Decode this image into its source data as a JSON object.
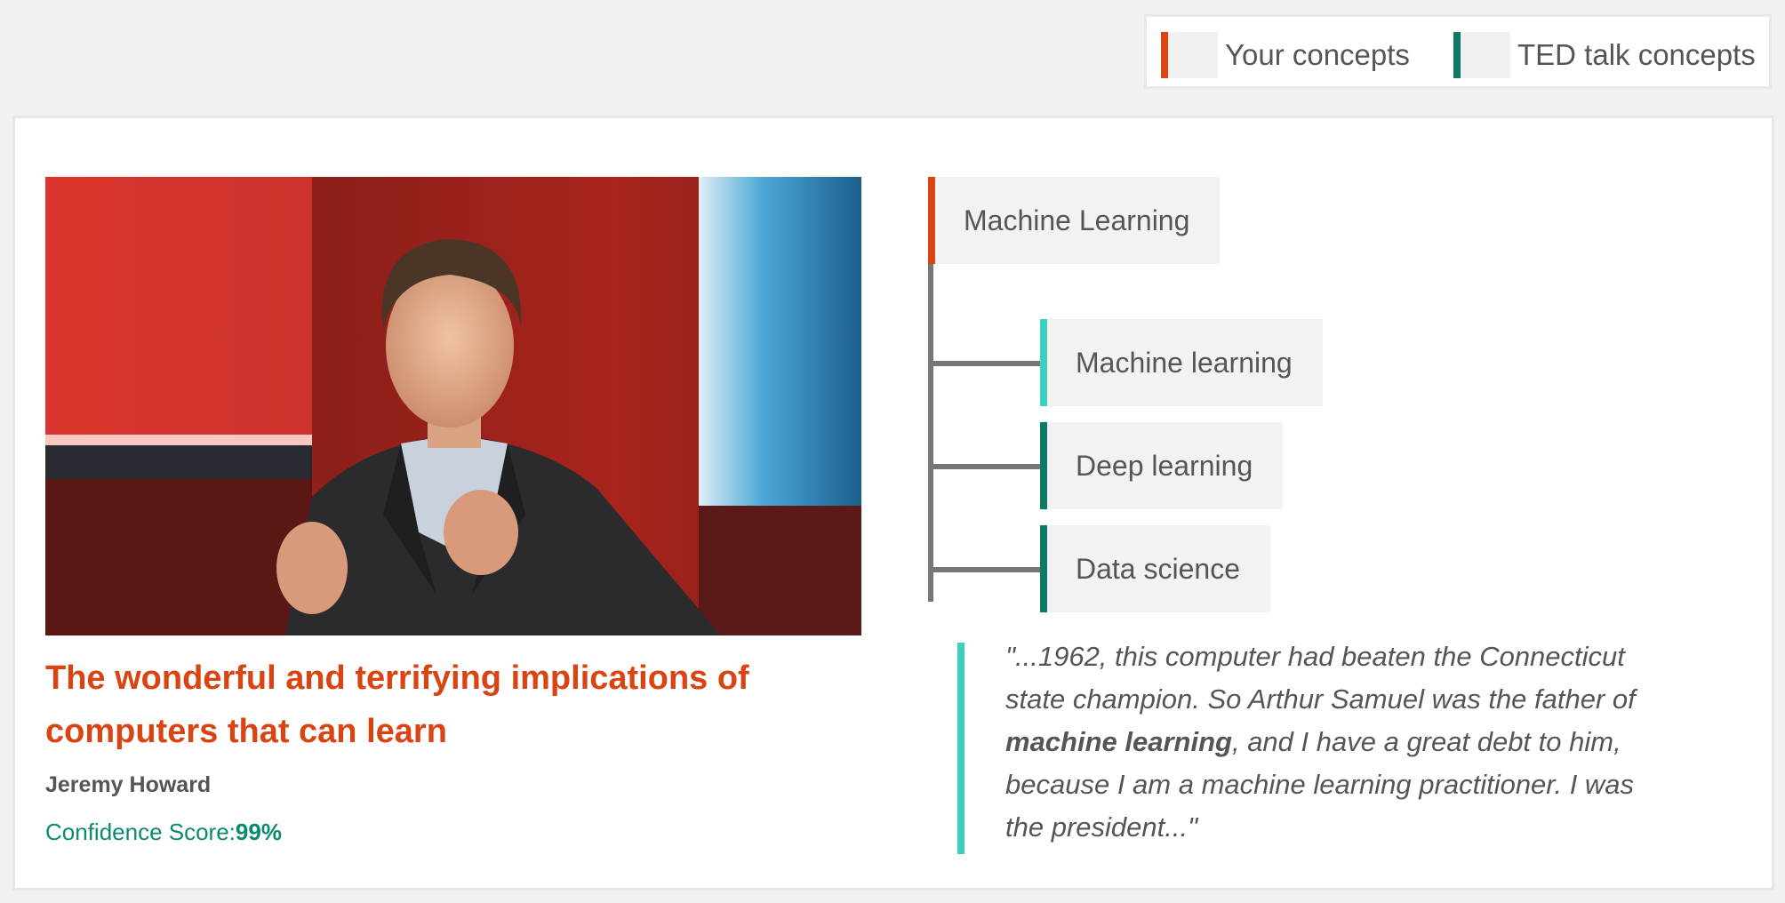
{
  "legend": {
    "items": [
      {
        "label": "Your concepts",
        "color": "#d94412"
      },
      {
        "label": "TED talk concepts",
        "color": "#0f7a63"
      }
    ]
  },
  "talk": {
    "title": "The wonderful and terrifying implications of computers that can learn",
    "speaker": "Jeremy Howard",
    "confidence_label": "Confidence Score:",
    "confidence_value": "99%",
    "image": "speaker-on-stage-photo"
  },
  "concepts": {
    "root": {
      "label": "Machine Learning",
      "color": "#d94412"
    },
    "children": [
      {
        "label": "Machine learning",
        "color": "#3ecfbf"
      },
      {
        "label": "Deep learning",
        "color": "#0f7a63"
      },
      {
        "label": "Data science",
        "color": "#0f7a63"
      }
    ]
  },
  "quote": {
    "before": "\"...1962, this computer had beaten the Connecticut state champion. So Arthur Samuel was the father of ",
    "highlight": "machine learning",
    "after": ", and I have a great debt to him, because I am a machine learning practitioner. I was the president...\"",
    "bar_color": "#3ecfbf"
  }
}
